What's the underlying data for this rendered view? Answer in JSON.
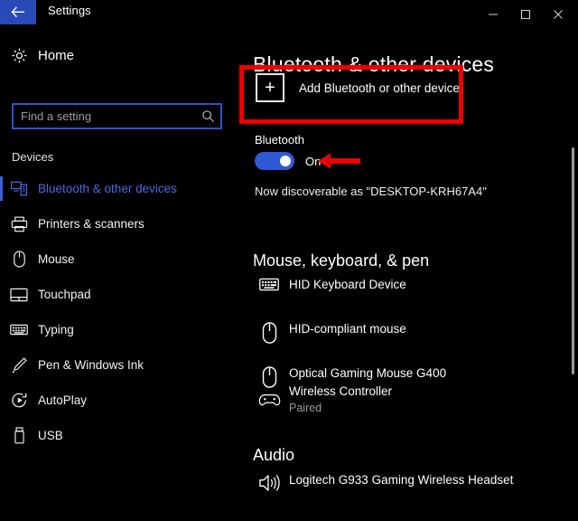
{
  "window": {
    "title": "Settings",
    "back_icon": "back-arrow-icon",
    "minimize_label": "─",
    "maximize_label": "□",
    "close_label": "✕"
  },
  "sidebar": {
    "home_label": "Home",
    "home_icon": "gear-icon",
    "search": {
      "placeholder": "Find a setting",
      "value": "",
      "icon": "search-icon"
    },
    "section_header": "Devices",
    "items": [
      {
        "label": "Bluetooth & other devices",
        "icon": "bluetooth-devices-icon",
        "selected": true
      },
      {
        "label": "Printers & scanners",
        "icon": "printer-icon",
        "selected": false
      },
      {
        "label": "Mouse",
        "icon": "mouse-icon",
        "selected": false
      },
      {
        "label": "Touchpad",
        "icon": "touchpad-icon",
        "selected": false
      },
      {
        "label": "Typing",
        "icon": "keyboard-icon",
        "selected": false
      },
      {
        "label": "Pen & Windows Ink",
        "icon": "pen-icon",
        "selected": false
      },
      {
        "label": "AutoPlay",
        "icon": "autoplay-icon",
        "selected": false
      },
      {
        "label": "USB",
        "icon": "usb-icon",
        "selected": false
      }
    ]
  },
  "main": {
    "page_title": "Bluetooth & other devices",
    "add_device": {
      "label": "Add Bluetooth or other device",
      "icon": "plus-icon"
    },
    "bluetooth": {
      "label": "Bluetooth",
      "state": "On",
      "enabled": true,
      "discoverable_text": "Now discoverable as \"DESKTOP-KRH67A4\""
    },
    "groups": [
      {
        "title": "Mouse, keyboard, & pen",
        "devices": [
          {
            "name": "HID Keyboard Device",
            "status": "",
            "icon": "keyboard-icon"
          },
          {
            "name": "HID-compliant mouse",
            "status": "",
            "icon": "mouse-icon"
          },
          {
            "name": "Optical Gaming Mouse G400",
            "status": "",
            "icon": "mouse-icon"
          },
          {
            "name": "Wireless Controller",
            "status": "Paired",
            "icon": "gamepad-icon"
          }
        ]
      },
      {
        "title": "Audio",
        "devices": [
          {
            "name": "Logitech G933 Gaming Wireless Headset",
            "status": "",
            "icon": "speaker-icon"
          }
        ]
      }
    ]
  },
  "annotations": {
    "highlight_box_target": "Add Bluetooth or other device",
    "arrow_target": "Bluetooth toggle",
    "color": "#ee0000"
  },
  "colors": {
    "accent": "#2f5ad6",
    "selected_text": "#4a6ae0",
    "background": "#000000",
    "annotation_red": "#ee0000"
  }
}
